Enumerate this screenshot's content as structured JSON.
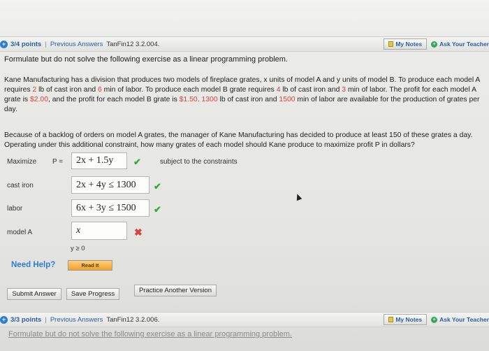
{
  "top_bar": {
    "points": "3/4 points",
    "separator": "|",
    "previous_answers": "Previous Answers",
    "problem_id": "TanFin12 3.2.004.",
    "my_notes": "My Notes",
    "ask_teacher": "Ask Your Teacher"
  },
  "instruction": "Formulate but do not solve the following exercise as a linear programming problem.",
  "paragraph1": [
    {
      "t": "Kane Manufacturing has a division that produces two models of fireplace grates, x units of model A and y units of model B. To produce each model A requires "
    },
    {
      "t": "2",
      "red": true
    },
    {
      "t": " lb of cast iron and "
    },
    {
      "t": "6",
      "red": true
    },
    {
      "t": " min of labor. To produce each model B grate requires "
    },
    {
      "t": "4",
      "red": true
    },
    {
      "t": " lb of cast iron and "
    },
    {
      "t": "3",
      "red": true
    },
    {
      "t": " min of labor. The profit for each model A grate is "
    },
    {
      "t": "$2.00",
      "red": true
    },
    {
      "t": ", and the profit for each model B grate is "
    },
    {
      "t": "$1.50",
      "red": true
    },
    {
      "t": ". "
    },
    {
      "t": "1300",
      "red": true
    },
    {
      "t": " lb of cast iron and "
    },
    {
      "t": "1500",
      "red": true
    },
    {
      "t": " min of labor are available for the production of grates per day."
    }
  ],
  "paragraph2": "Because of a backlog of orders on model A grates, the manager of Kane Manufacturing has decided to produce at least 150 of these grates a day. Operating under this additional constraint, how many grates of each model should Kane produce to maximize profit P in dollars?",
  "objective": {
    "label": "Maximize",
    "p_label": "P =",
    "expression": "2x + 1.5y",
    "subject_to": "subject to the constraints"
  },
  "constraints": [
    {
      "label": "cast iron",
      "value": "2x + 4y ≤ 1300",
      "status": "correct"
    },
    {
      "label": "labor",
      "value": "6x + 3y ≤ 1500",
      "status": "correct"
    },
    {
      "label": "model A",
      "value": "x",
      "status": "incorrect"
    }
  ],
  "nonnegativity": "y ≥ 0",
  "help": {
    "label": "Need Help?",
    "read_it": "Read It"
  },
  "actions": {
    "submit": "Submit Answer",
    "save": "Save Progress",
    "practice": "Practice Another Version"
  },
  "next_bar": {
    "points": "3/3 points",
    "separator": "|",
    "previous_answers": "Previous Answers",
    "problem_id": "TanFin12 3.2.006.",
    "my_notes": "My Notes",
    "ask_teacher": "Ask Your Teacher"
  },
  "next_instruction": "Formulate but do not solve the following exercise as a linear programming problem.",
  "colors": {
    "accent_blue": "#2a7fd4",
    "correct_green": "#2fae3a",
    "incorrect_red": "#e0403a"
  }
}
